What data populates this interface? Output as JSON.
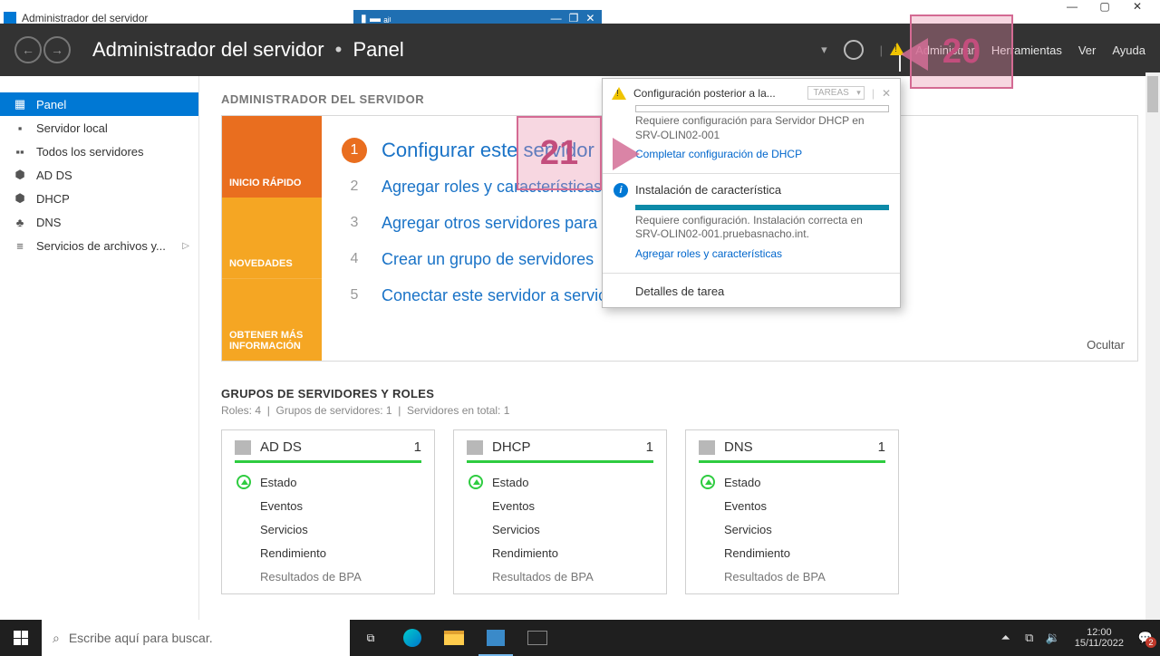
{
  "outer_window": {
    "title": ""
  },
  "app_title": "Administrador del servidor",
  "header": {
    "breadcrumb_app": "Administrador del servidor",
    "breadcrumb_page": "Panel",
    "menu": {
      "administrar": "Administrar",
      "herramientas": "Herramientas",
      "ver": "Ver",
      "ayuda": "Ayuda"
    }
  },
  "sidebar": {
    "items": [
      {
        "label": "Panel",
        "active": true,
        "icon": "dashboard"
      },
      {
        "label": "Servidor local",
        "icon": "server"
      },
      {
        "label": "Todos los servidores",
        "icon": "servers"
      },
      {
        "label": "AD DS",
        "icon": "adds"
      },
      {
        "label": "DHCP",
        "icon": "dhcp"
      },
      {
        "label": "DNS",
        "icon": "dns"
      },
      {
        "label": "Servicios de archivos y...",
        "icon": "files",
        "chevron": true
      }
    ]
  },
  "welcome": {
    "heading": "ADMINISTRADOR DEL SERVIDOR",
    "tabs": {
      "quick": "INICIO RÁPIDO",
      "news": "NOVEDADES",
      "more": "OBTENER MÁS INFORMACIÓN"
    },
    "steps": [
      "Configurar este servidor local",
      "Agregar roles y características",
      "Agregar otros servidores para administrar",
      "Crear un grupo de servidores",
      "Conectar este servidor a servicios de nube"
    ],
    "hide": "Ocultar"
  },
  "groups": {
    "title": "GRUPOS DE SERVIDORES Y ROLES",
    "sub_roles": "Roles: 4",
    "sub_groups": "Grupos de servidores: 1",
    "sub_total": "Servidores en total: 1",
    "rows": {
      "estado": "Estado",
      "eventos": "Eventos",
      "servicios": "Servicios",
      "rendimiento": "Rendimiento",
      "bpa": "Resultados de BPA"
    },
    "tiles": [
      {
        "name": "AD DS",
        "count": "1"
      },
      {
        "name": "DHCP",
        "count": "1"
      },
      {
        "name": "DNS",
        "count": "1"
      }
    ]
  },
  "notif": {
    "title": "Configuración posterior a la...",
    "tareas": "TAREAS",
    "msg1a": "Requiere configuración para Servidor DHCP en SRV-OLIN02-001",
    "link1": "Completar configuración de DHCP",
    "sec2_title": "Instalación de característica",
    "msg2": "Requiere configuración. Instalación correcta en SRV-OLIN02-001.pruebasnacho.int.",
    "link2": "Agregar roles y características",
    "footer": "Detalles de tarea"
  },
  "annotations": {
    "a20": "20",
    "a21": "21"
  },
  "taskbar": {
    "search_placeholder": "Escribe aquí para buscar.",
    "clock_time": "12:00",
    "clock_date": "15/11/2022"
  }
}
